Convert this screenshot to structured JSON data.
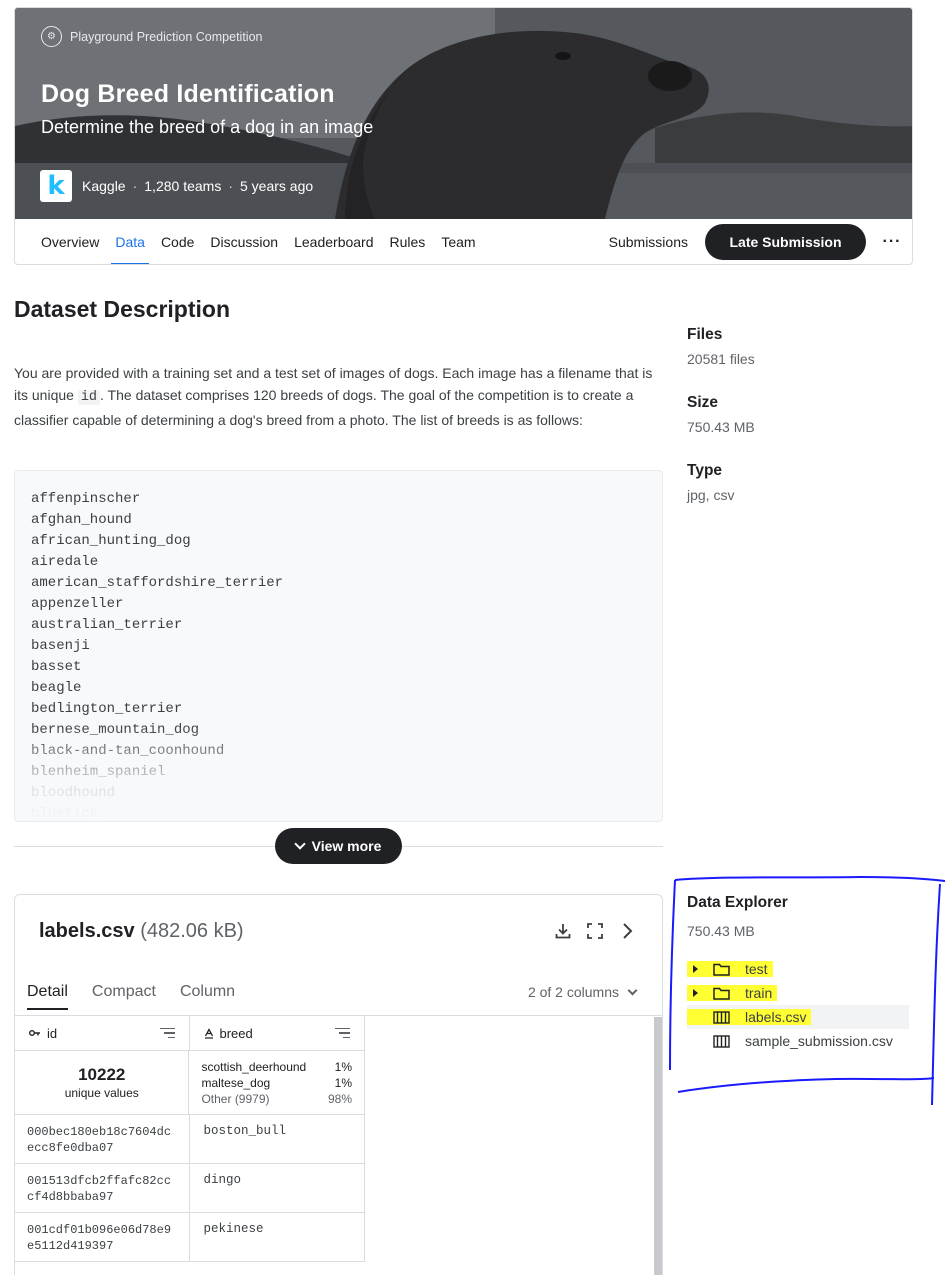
{
  "hero": {
    "competition_type": "Playground Prediction Competition",
    "title": "Dog Breed Identification",
    "subtitle": "Determine the breed of a dog in an image",
    "host": "Kaggle",
    "teams": "1,280 teams",
    "age": "5 years ago",
    "logo_letter": "k"
  },
  "tabs": [
    "Overview",
    "Data",
    "Code",
    "Discussion",
    "Leaderboard",
    "Rules",
    "Team"
  ],
  "active_tab": "Data",
  "header_actions": {
    "submissions": "Submissions",
    "late_submission": "Late Submission",
    "more": "···"
  },
  "description": {
    "title": "Dataset Description",
    "para_before_code": "You are provided with a training set and a test set of images of dogs. Each image has a filename that is its unique ",
    "code_word": "id",
    "para_after_code": ". The dataset comprises 120 breeds of dogs. The goal of the competition is to create a classifier capable of determining a dog's breed from a photo. The list of breeds is as follows:",
    "breeds": [
      "affenpinscher",
      "afghan_hound",
      "african_hunting_dog",
      "airedale",
      "american_staffordshire_terrier",
      "appenzeller",
      "australian_terrier",
      "basenji",
      "basset",
      "beagle",
      "bedlington_terrier",
      "bernese_mountain_dog",
      "black-and-tan_coonhound",
      "blenheim_spaniel",
      "bloodhound",
      "bluetick"
    ],
    "view_more": "View more"
  },
  "stats": {
    "files_label": "Files",
    "files_value": "20581 files",
    "size_label": "Size",
    "size_value": "750.43 MB",
    "type_label": "Type",
    "type_value": "jpg, csv"
  },
  "file_preview": {
    "name": "labels.csv",
    "size": "(482.06 kB)",
    "tabs": [
      "Detail",
      "Compact",
      "Column"
    ],
    "active_tab": "Detail",
    "column_count": "2 of 2 columns",
    "columns": [
      {
        "name": "id",
        "type_icon": "key-icon"
      },
      {
        "name": "breed",
        "type_icon": "string-type-icon"
      }
    ],
    "id_summary": {
      "value": "10222",
      "label": "unique values"
    },
    "breed_summary": [
      {
        "label": "scottish_deerhound",
        "pct": "1%"
      },
      {
        "label": "maltese_dog",
        "pct": "1%"
      },
      {
        "label": "Other (9979)",
        "pct": "98%"
      }
    ],
    "rows": [
      {
        "id": "000bec180eb18c7604dcecc8fe0dba07",
        "breed": "boston_bull"
      },
      {
        "id": "001513dfcb2ffafc82cccf4d8bbaba97",
        "breed": "dingo"
      },
      {
        "id": "001cdf01b096e06d78e9e5112d419397",
        "breed": "pekinese"
      }
    ]
  },
  "explorer": {
    "title": "Data Explorer",
    "size": "750.43 MB",
    "items": [
      {
        "name": "test",
        "kind": "folder",
        "highlighted": true
      },
      {
        "name": "train",
        "kind": "folder",
        "highlighted": true
      },
      {
        "name": "labels.csv",
        "kind": "table",
        "highlighted": true,
        "selected": true
      },
      {
        "name": "sample_submission.csv",
        "kind": "table",
        "highlighted": false
      }
    ]
  },
  "colors": {
    "accent": "#1a73e8",
    "dark_button": "#202124",
    "highlight": "#ffff33",
    "annotation_ink": "#1a1aff"
  }
}
